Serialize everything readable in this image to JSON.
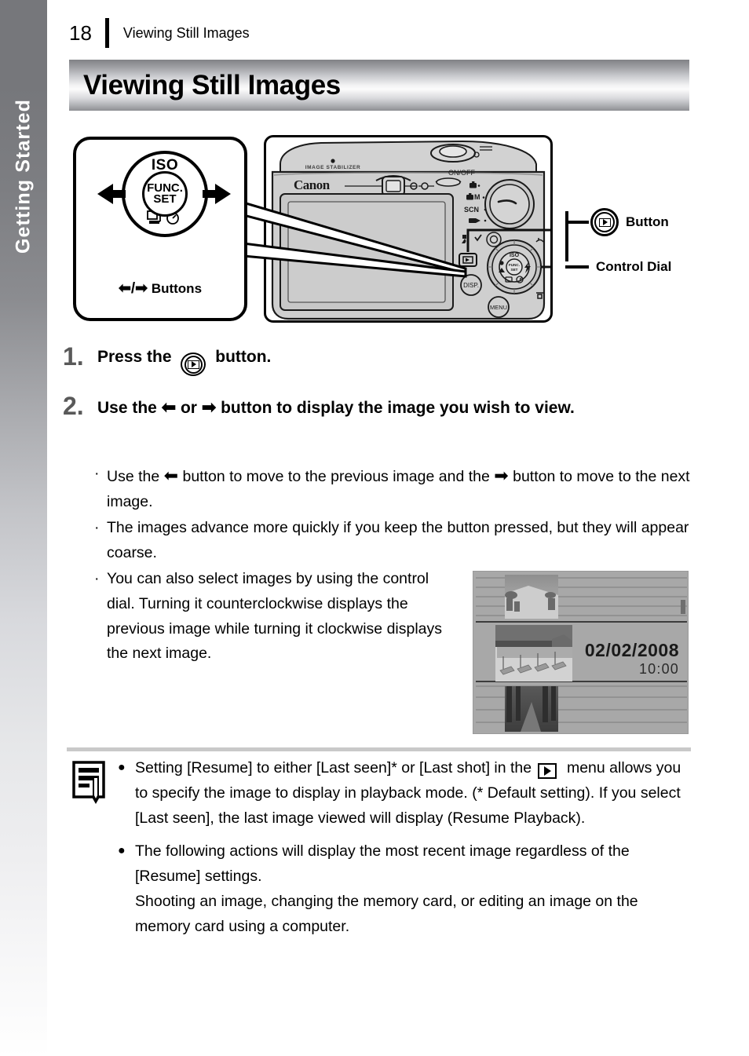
{
  "sidebar": {
    "label": "Getting Started"
  },
  "header": {
    "page_number": "18",
    "running_title": "Viewing Still Images"
  },
  "title_banner": {
    "text": "Viewing Still Images"
  },
  "diagram": {
    "controller_caption": "Buttons",
    "controller_caption_arrows": "⬅/➡",
    "iso_label": "ISO",
    "func_label": "FUNC.",
    "set_label": "SET",
    "flash_label": "⚡",
    "drive_timer_label": "❐ ⏱",
    "macro_label": "❀\n▲",
    "camera_brand": "Canon",
    "image_stabilizer": "IMAGE STABILIZER",
    "on_off": "ON/OFF",
    "disp_label": "DISP.",
    "menu_label": "MENU",
    "mode_dial_items": [
      "📷",
      "M",
      "SCN",
      "▶"
    ],
    "label_button": "Button",
    "label_control_dial": "Control Dial",
    "play_icon_name": "playback-icon"
  },
  "steps": [
    {
      "number": "1.",
      "text_before": "Press the",
      "icon": "playback-icon",
      "text_after": "button."
    },
    {
      "number": "2.",
      "text_before": "Use the",
      "arrow_left": "⬅",
      "text_middle": "or",
      "arrow_right": "➡",
      "text_after": "button to display the image you wish to view."
    }
  ],
  "bullets": [
    {
      "part1": "Use the",
      "arrow1": "⬅",
      "part2": "button to move to the previous image and the",
      "arrow2": "➡",
      "part3": "button to move to the next image."
    },
    {
      "text": "The images advance more quickly if you keep the button pressed, but they will appear coarse."
    },
    {
      "text": "You can also select images by using the control dial. Turning it counterclockwise displays the previous image while turning it clockwise displays the next image."
    }
  ],
  "lcd": {
    "date": "02/02/2008",
    "time": "10:00"
  },
  "note": {
    "icon_name": "memo-pencil-icon",
    "items": [
      {
        "part1": "Setting [Resume] to either [Last seen]* or [Last shot] in the",
        "icon": "playback-menu-icon",
        "part2": "menu allows you to specify the image to display in playback mode. (* Default setting). If you select [Last seen], the last image viewed will display (Resume Playback)."
      },
      {
        "part1": "The following actions will display the most recent image regardless of the [Resume] settings.",
        "part2": "Shooting an image, changing the memory card, or editing an image on the memory card using a computer."
      }
    ]
  },
  "colors": {
    "tab_top": "#76777b",
    "step_number": "#595959",
    "separator": "#c9c9c9",
    "lcd_background": "#a8a8a8",
    "camera_body": "#cfcfcf"
  }
}
